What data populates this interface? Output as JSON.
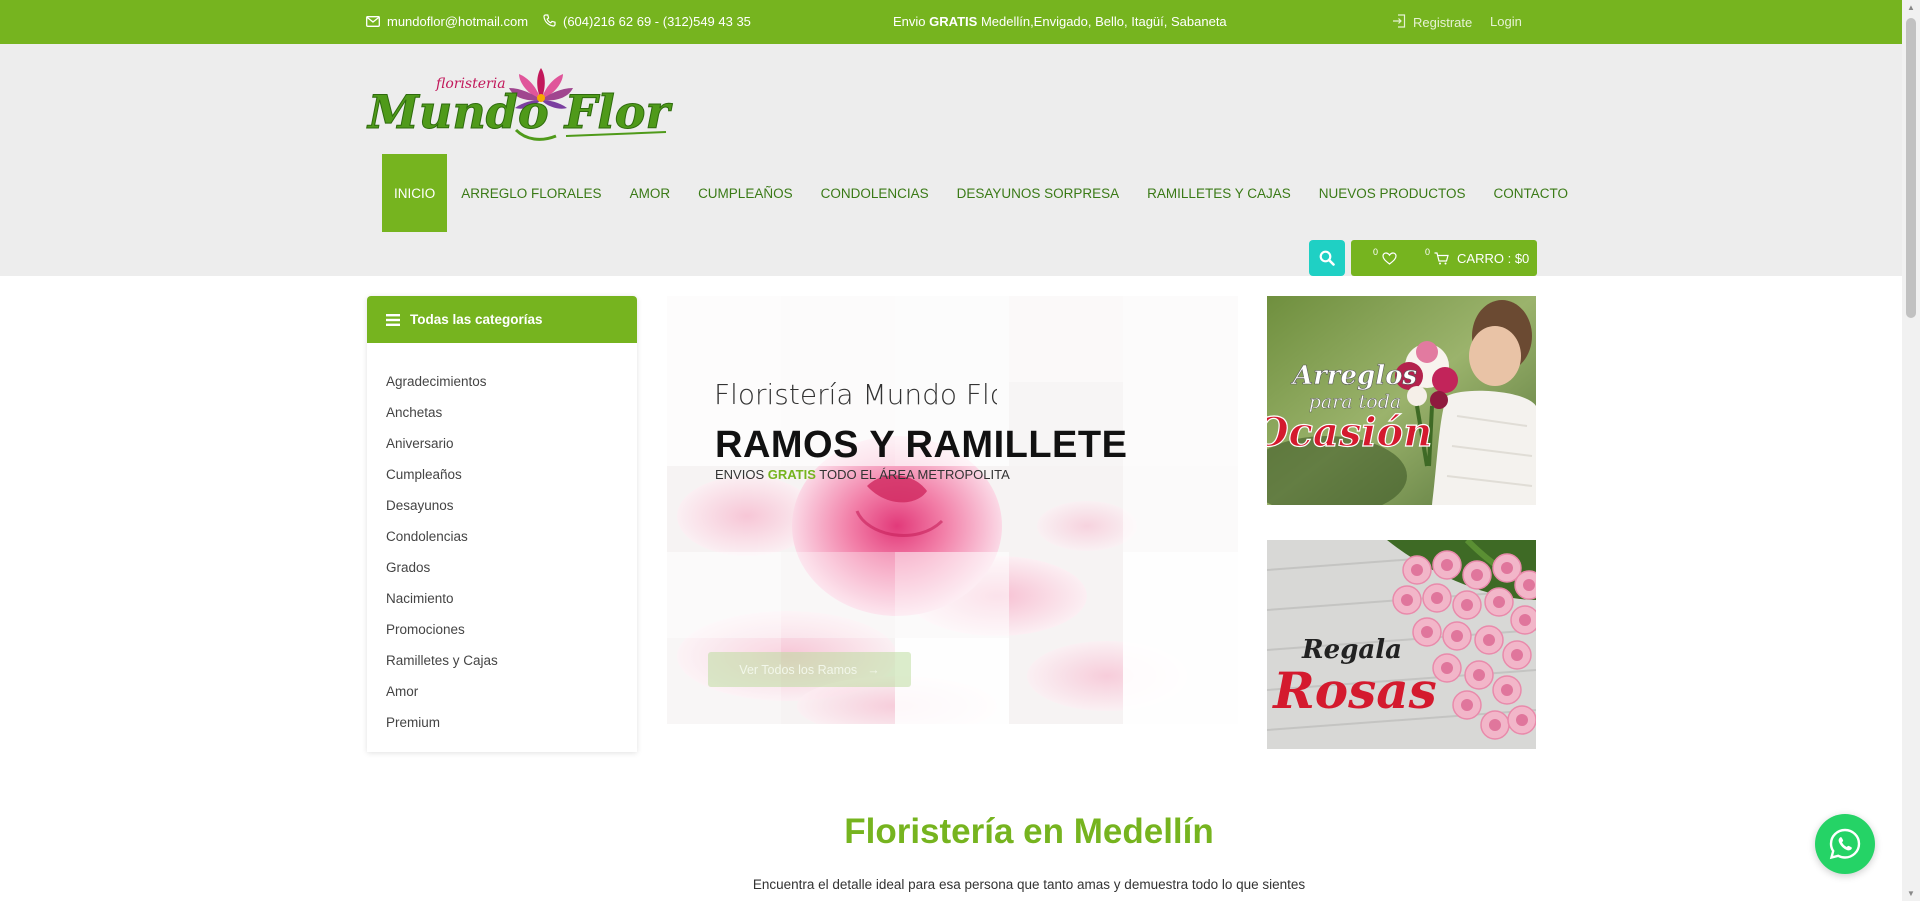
{
  "topbar": {
    "email": "mundoflor@hotmail.com",
    "phone": "(604)216 62 69 - (312)549 43 35",
    "shipping_prefix": "Envio",
    "shipping_bold": "GRATIS",
    "shipping_rest": "Medellín,Envigado, Bello, Itagüí, Sabaneta",
    "register": "Registrate",
    "login": "Login",
    "icons": {
      "email": "envelope-icon",
      "phone": "phone-icon",
      "register": "login-arrow-icon"
    }
  },
  "brand": {
    "logo_small": "floristeria",
    "logo_main": "Mundo Flor",
    "colors": {
      "green": "#76b41f",
      "dark_green": "#3a7a16",
      "pink": "#c2185b"
    }
  },
  "nav": {
    "items": [
      "INICIO",
      "ARREGLO FLORALES",
      "AMOR",
      "CUMPLEAÑOS",
      "CONDOLENCIAS",
      "DESAYUNOS SORPRESA",
      "RAMILLETES Y CAJAS",
      "NUEVOS PRODUCTOS",
      "CONTACTO"
    ],
    "active": "INICIO"
  },
  "actions": {
    "search_icon": "search-icon",
    "wishlist_count": "0",
    "cart_count": "0",
    "cart_label": "CARRO : $0"
  },
  "sidebar": {
    "title": "Todas las categorías",
    "categories": [
      "Agradecimientos",
      "Anchetas",
      "Aniversario",
      "Cumpleaños",
      "Desayunos",
      "Condolencias",
      "Grados",
      "Nacimiento",
      "Promociones",
      "Ramilletes y Cajas",
      "Amor",
      "Premium"
    ]
  },
  "hero": {
    "subtitle": "Floristería Mundo Flor",
    "title": "RAMOS Y RAMILLETE",
    "tag_prefix": "ENVIOS",
    "tag_highlight": "GRATIS",
    "tag_rest": "TODO EL ÁREA METROPOLITA",
    "cta": "Ver Todos los Ramos",
    "cta_arrow": "→"
  },
  "banners": [
    {
      "line1": "Arreglos",
      "line2": "para toda",
      "line3": "Ocasión"
    },
    {
      "line1": "Regala",
      "line2": "Rosas"
    }
  ],
  "section": {
    "title": "Floristería en Medellín",
    "subtitle": "Encuentra el detalle ideal para esa persona que tanto amas y demuestra todo lo que sientes"
  },
  "whatsapp_icon": "whatsapp-icon"
}
